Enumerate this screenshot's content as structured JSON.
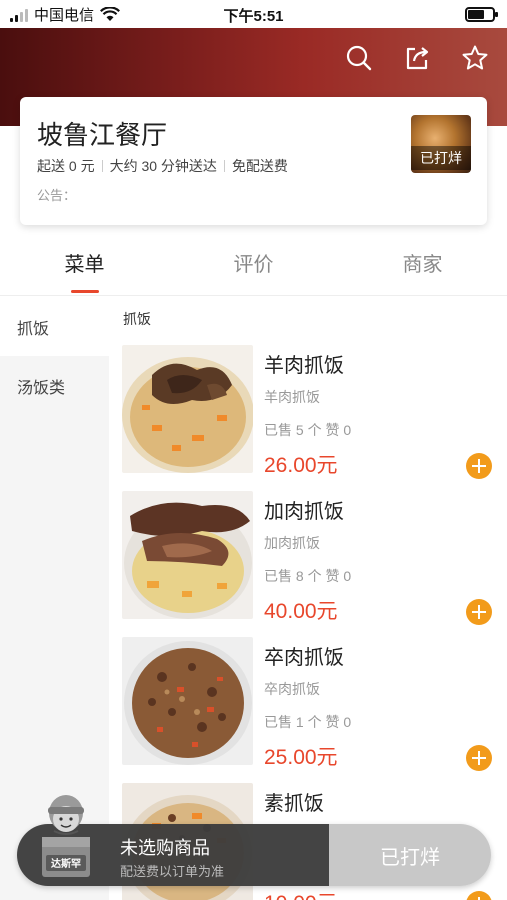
{
  "status_bar": {
    "carrier": "中国电信",
    "time": "下午5:51"
  },
  "shop": {
    "name": "坡鲁江餐厅",
    "min_order": "起送 0 元",
    "delivery_time": "大约 30 分钟送达",
    "delivery_fee": "免配送费",
    "notice": "公告：",
    "closed_badge": "已打烊"
  },
  "tabs": [
    {
      "label": "菜单",
      "active": true
    },
    {
      "label": "评价",
      "active": false
    },
    {
      "label": "商家",
      "active": false
    }
  ],
  "sidebar": {
    "items": [
      {
        "label": "抓饭",
        "active": true
      },
      {
        "label": "汤饭类",
        "active": false
      }
    ]
  },
  "menu": {
    "category": "抓饭",
    "items": [
      {
        "name": "羊肉抓饭",
        "desc": "羊肉抓饭",
        "stats": "已售 5 个 赞 0",
        "price": "26.00元"
      },
      {
        "name": "加肉抓饭",
        "desc": "加肉抓饭",
        "stats": "已售 8 个 赞 0",
        "price": "40.00元"
      },
      {
        "name": "卒肉抓饭",
        "desc": "卒肉抓饭",
        "stats": "已售 1 个 赞 0",
        "price": "25.00元"
      },
      {
        "name": "素抓饭",
        "desc": "",
        "stats": "",
        "price": "10.00元"
      }
    ]
  },
  "cart": {
    "title": "未选购商品",
    "subtitle": "配送费以订单为准",
    "button": "已打烊",
    "mascot_text": "达斯罕"
  },
  "colors": {
    "accent": "#e8472c",
    "add_button": "#f29b1b",
    "hero": "#7a1e1c"
  }
}
